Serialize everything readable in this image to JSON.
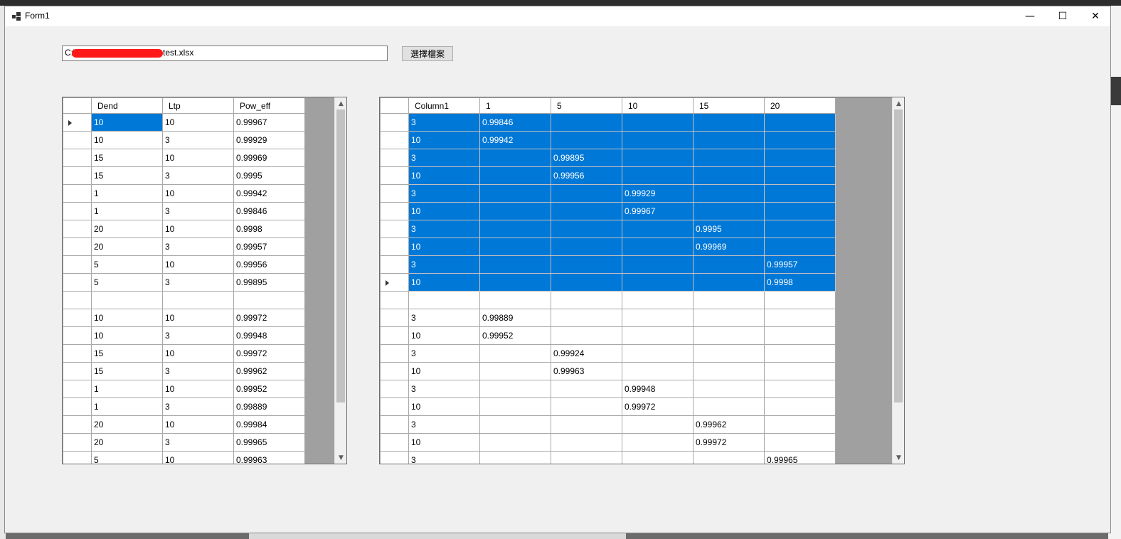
{
  "window": {
    "title": "Form1",
    "minimize_glyph": "—",
    "maximize_glyph": "☐",
    "close_glyph": "✕",
    "app_icon": "form-app-icon"
  },
  "path_field": {
    "prefix": "C:\\",
    "suffix": "test.xlsx"
  },
  "pick_button": {
    "label": "選擇檔案"
  },
  "left_grid": {
    "columns": [
      "Dend",
      "Ltp",
      "Pow_eff"
    ],
    "current_row": 0,
    "rows": [
      [
        "10",
        "10",
        "0.99967"
      ],
      [
        "10",
        "3",
        "0.99929"
      ],
      [
        "15",
        "10",
        "0.99969"
      ],
      [
        "15",
        "3",
        "0.9995"
      ],
      [
        "1",
        "10",
        "0.99942"
      ],
      [
        "1",
        "3",
        "0.99846"
      ],
      [
        "20",
        "10",
        "0.9998"
      ],
      [
        "20",
        "3",
        "0.99957"
      ],
      [
        "5",
        "10",
        "0.99956"
      ],
      [
        "5",
        "3",
        "0.99895"
      ],
      [
        "",
        "",
        ""
      ],
      [
        "10",
        "10",
        "0.99972"
      ],
      [
        "10",
        "3",
        "0.99948"
      ],
      [
        "15",
        "10",
        "0.99972"
      ],
      [
        "15",
        "3",
        "0.99962"
      ],
      [
        "1",
        "10",
        "0.99952"
      ],
      [
        "1",
        "3",
        "0.99889"
      ],
      [
        "20",
        "10",
        "0.99984"
      ],
      [
        "20",
        "3",
        "0.99965"
      ],
      [
        "5",
        "10",
        "0.99963"
      ]
    ]
  },
  "right_grid": {
    "columns": [
      "Column1",
      "1",
      "5",
      "10",
      "15",
      "20"
    ],
    "selected_rows": 10,
    "current_row": 9,
    "rows": [
      [
        "3",
        "0.99846",
        "",
        "",
        "",
        ""
      ],
      [
        "10",
        "0.99942",
        "",
        "",
        "",
        ""
      ],
      [
        "3",
        "",
        "0.99895",
        "",
        "",
        ""
      ],
      [
        "10",
        "",
        "0.99956",
        "",
        "",
        ""
      ],
      [
        "3",
        "",
        "",
        "0.99929",
        "",
        ""
      ],
      [
        "10",
        "",
        "",
        "0.99967",
        "",
        ""
      ],
      [
        "3",
        "",
        "",
        "",
        "0.9995",
        ""
      ],
      [
        "10",
        "",
        "",
        "",
        "0.99969",
        ""
      ],
      [
        "3",
        "",
        "",
        "",
        "",
        "0.99957"
      ],
      [
        "10",
        "",
        "",
        "",
        "",
        "0.9998"
      ],
      [
        "",
        "",
        "",
        "",
        "",
        ""
      ],
      [
        "3",
        "0.99889",
        "",
        "",
        "",
        ""
      ],
      [
        "10",
        "0.99952",
        "",
        "",
        "",
        ""
      ],
      [
        "3",
        "",
        "0.99924",
        "",
        "",
        ""
      ],
      [
        "10",
        "",
        "0.99963",
        "",
        "",
        ""
      ],
      [
        "3",
        "",
        "",
        "0.99948",
        "",
        ""
      ],
      [
        "10",
        "",
        "",
        "0.99972",
        "",
        ""
      ],
      [
        "3",
        "",
        "",
        "",
        "0.99962",
        ""
      ],
      [
        "10",
        "",
        "",
        "",
        "0.99972",
        ""
      ],
      [
        "3",
        "",
        "",
        "",
        "",
        "0.99965"
      ]
    ]
  },
  "scrollbar": {
    "up_glyph": "▲",
    "down_glyph": "▼"
  },
  "colors": {
    "selection": "#0078d7",
    "grid_background": "#a0a0a0",
    "form_background": "#f0f0f0"
  }
}
